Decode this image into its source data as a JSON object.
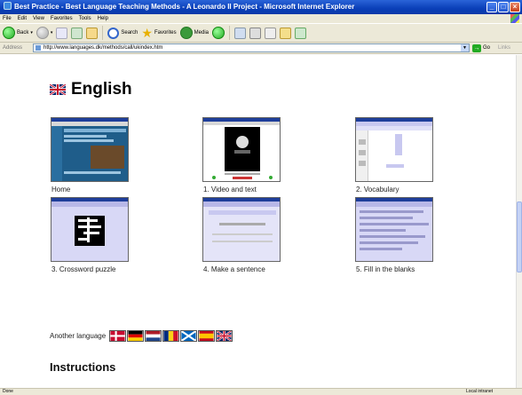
{
  "window": {
    "title": "Best Practice - Best Language Teaching Methods - A Leonardo II Project - Microsoft Internet Explorer",
    "minimize": "_",
    "maximize": "□",
    "close": "×"
  },
  "menu": [
    "File",
    "Edit",
    "View",
    "Favorites",
    "Tools",
    "Help"
  ],
  "toolbar": {
    "back": "Back",
    "search": "Search",
    "favorites": "Favorites",
    "media": "Media"
  },
  "address": {
    "label": "Address",
    "url": "http://www.languages.dk/methods/call/ukindex.htm",
    "go": "Go",
    "links": "Links"
  },
  "page": {
    "heading": "English",
    "items": [
      {
        "label": "Home",
        "thumb": "home"
      },
      {
        "label": "1. Video and text",
        "thumb": "video"
      },
      {
        "label": "2. Vocabulary",
        "thumb": "vocabulary"
      },
      {
        "label": "3. Crossword puzzle",
        "thumb": "crossword"
      },
      {
        "label": "4. Make a sentence",
        "thumb": "sentence"
      },
      {
        "label": "5. Fill in the blanks",
        "thumb": "blanks"
      }
    ],
    "another_language": "Another language",
    "flags": [
      "danish-flag",
      "german-flag",
      "dutch-flag",
      "romanian-flag",
      "scottish-flag",
      "spanish-flag",
      "uk-flag"
    ],
    "instructions": "Instructions"
  },
  "status": {
    "left": "Done",
    "zone": "Local intranet"
  },
  "colors": {
    "ie_blue": "#0a3fb8",
    "lavender": "#c8c8f0",
    "chrome": "#ece9d8"
  }
}
